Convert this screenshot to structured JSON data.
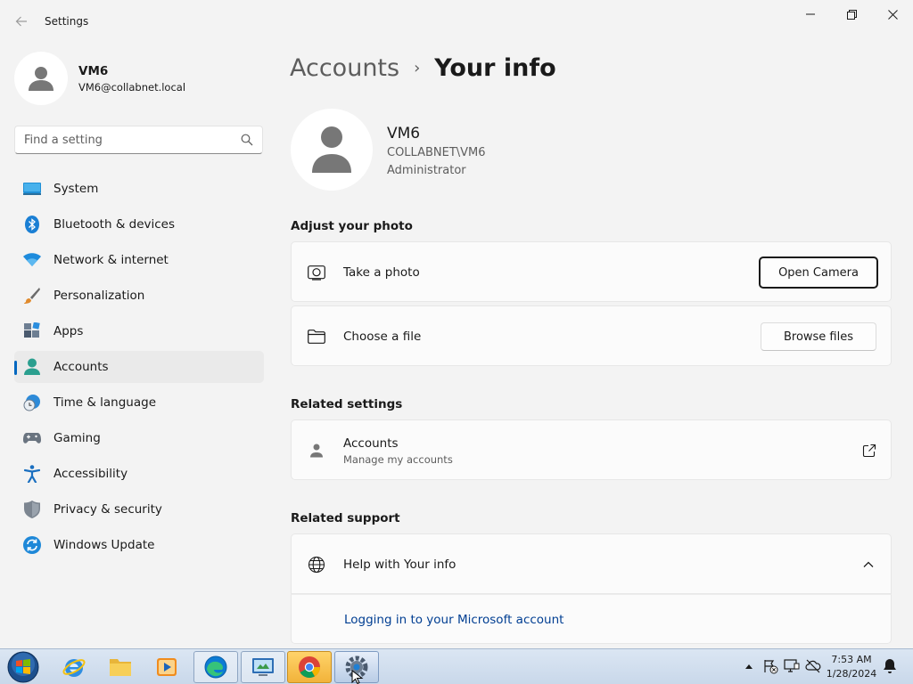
{
  "app": {
    "title": "Settings"
  },
  "profile": {
    "name": "VM6",
    "email": "VM6@collabnet.local"
  },
  "search": {
    "placeholder": "Find a setting"
  },
  "sidebar": {
    "items": [
      {
        "label": "System",
        "icon": "monitor-icon"
      },
      {
        "label": "Bluetooth & devices",
        "icon": "bluetooth-icon"
      },
      {
        "label": "Network & internet",
        "icon": "wifi-icon"
      },
      {
        "label": "Personalization",
        "icon": "paintbrush-icon"
      },
      {
        "label": "Apps",
        "icon": "apps-icon"
      },
      {
        "label": "Accounts",
        "icon": "person-icon",
        "active": true
      },
      {
        "label": "Time & language",
        "icon": "globe-clock-icon"
      },
      {
        "label": "Gaming",
        "icon": "gamepad-icon"
      },
      {
        "label": "Accessibility",
        "icon": "accessibility-icon"
      },
      {
        "label": "Privacy & security",
        "icon": "shield-icon"
      },
      {
        "label": "Windows Update",
        "icon": "update-icon"
      }
    ]
  },
  "breadcrumb": {
    "parent": "Accounts",
    "separator": "›",
    "current": "Your info"
  },
  "user": {
    "name": "VM6",
    "domain": "COLLABNET\\VM6",
    "role": "Administrator"
  },
  "adjust_photo": {
    "heading": "Adjust your photo",
    "take_photo": {
      "label": "Take a photo",
      "button": "Open Camera"
    },
    "choose_file": {
      "label": "Choose a file",
      "button": "Browse files"
    }
  },
  "related_settings": {
    "heading": "Related settings",
    "accounts": {
      "title": "Accounts",
      "subtitle": "Manage my accounts"
    }
  },
  "related_support": {
    "heading": "Related support",
    "help": {
      "title": "Help with Your info",
      "link": "Logging in to your Microsoft account"
    }
  },
  "taskbar": {
    "apps": [
      "internet-explorer-icon",
      "file-explorer-icon",
      "media-player-icon",
      "edge-icon",
      "control-panel-icon",
      "chrome-icon",
      "settings-icon"
    ],
    "clock": {
      "time": "7:53 AM",
      "date": "1/28/2024"
    }
  },
  "colors": {
    "accent": "#0067c0",
    "link": "#003e92",
    "background": "#f3f3f3",
    "card": "#fbfbfb"
  }
}
